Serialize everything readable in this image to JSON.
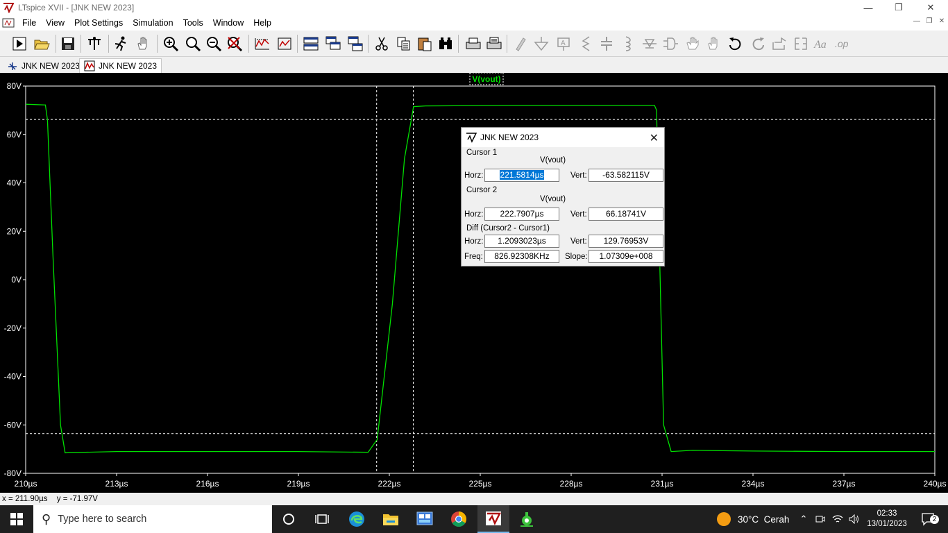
{
  "window": {
    "title": "LTspice XVII - [JNK NEW 2023]"
  },
  "menu": [
    "File",
    "View",
    "Plot Settings",
    "Simulation",
    "Tools",
    "Window",
    "Help"
  ],
  "toolbar_icons": [
    "run-icon",
    "open-icon",
    "save-icon",
    "control-panel-icon",
    "run-sim-icon",
    "pan-icon",
    "zoom-in-icon",
    "zoom-area-icon",
    "zoom-out-icon",
    "zoom-cancel-icon",
    "autorange-icon",
    "manual-limits-icon",
    "tile-horizontal-icon",
    "cascade-icon",
    "tile-vertical-icon",
    "cut-icon",
    "copy-icon",
    "paste-icon",
    "find-icon",
    "print-icon",
    "print-setup-icon",
    "wire-icon",
    "ground-icon",
    "label-icon",
    "resistor-icon",
    "capacitor-icon",
    "inductor-icon",
    "diode-icon",
    "component-icon",
    "move-icon",
    "drag-icon",
    "undo-icon",
    "redo-icon",
    "rotate-icon",
    "mirror-icon",
    "text-icon",
    "spice-directive-icon"
  ],
  "tabs": [
    {
      "label": "JNK NEW 2023",
      "icon": "schematic-icon"
    },
    {
      "label": "JNK NEW 2023",
      "icon": "waveform-icon"
    }
  ],
  "plot": {
    "trace_label": "V(vout)",
    "trace_color": "#00e000",
    "y_ticks": [
      "80V",
      "60V",
      "40V",
      "20V",
      "0V",
      "-20V",
      "-40V",
      "-60V",
      "-80V"
    ],
    "x_ticks": [
      "210µs",
      "213µs",
      "216µs",
      "219µs",
      "222µs",
      "225µs",
      "228µs",
      "231µs",
      "234µs",
      "237µs",
      "240µs"
    ]
  },
  "chart_data": {
    "type": "line",
    "title": "",
    "xlabel": "",
    "ylabel": "",
    "xlim": [
      210,
      240
    ],
    "ylim": [
      -80,
      80
    ],
    "series": [
      {
        "name": "V(vout)",
        "x": [
          210,
          210.65,
          210.72,
          210.9,
          211.15,
          211.3,
          213,
          216,
          219,
          221.3,
          221.6,
          222.1,
          222.5,
          222.8,
          223.2,
          226,
          229,
          230.75,
          230.82,
          230.9,
          231.05,
          231.3,
          232,
          234,
          237,
          240
        ],
        "y": [
          72.5,
          72.2,
          66,
          10,
          -60,
          -71.5,
          -71,
          -71,
          -71,
          -71.3,
          -66,
          -10,
          50,
          71.5,
          71.8,
          72,
          72,
          72,
          70,
          20,
          -60,
          -71,
          -70.5,
          -70.8,
          -71,
          -71
        ]
      }
    ],
    "cursors": {
      "cursor1_x": 221.5814,
      "cursor1_y": -63.582115,
      "cursor2_x": 222.7907,
      "cursor2_y": 66.18741
    }
  },
  "cursor_dialog": {
    "title": "JNK NEW 2023",
    "cursor1_heading": "Cursor 1",
    "cursor2_heading": "Cursor 2",
    "diff_heading": "Diff (Cursor2 - Cursor1)",
    "trace": "V(vout)",
    "horz_label": "Horz:",
    "vert_label": "Vert:",
    "freq_label": "Freq:",
    "slope_label": "Slope:",
    "c1_horz": "221.5814µs",
    "c1_vert": "-63.582115V",
    "c2_horz": "222.7907µs",
    "c2_vert": "66.18741V",
    "diff_horz": "1.2093023µs",
    "diff_vert": "129.76953V",
    "freq": "826.92308KHz",
    "slope": "1.07309e+008"
  },
  "status": {
    "x": "x = 211.90µs",
    "y": "y = -71.97V"
  },
  "taskbar": {
    "search_placeholder": "Type here to search",
    "weather": "30°C  Cerah",
    "time": "02:33",
    "date": "13/01/2023",
    "notifications": "2"
  }
}
